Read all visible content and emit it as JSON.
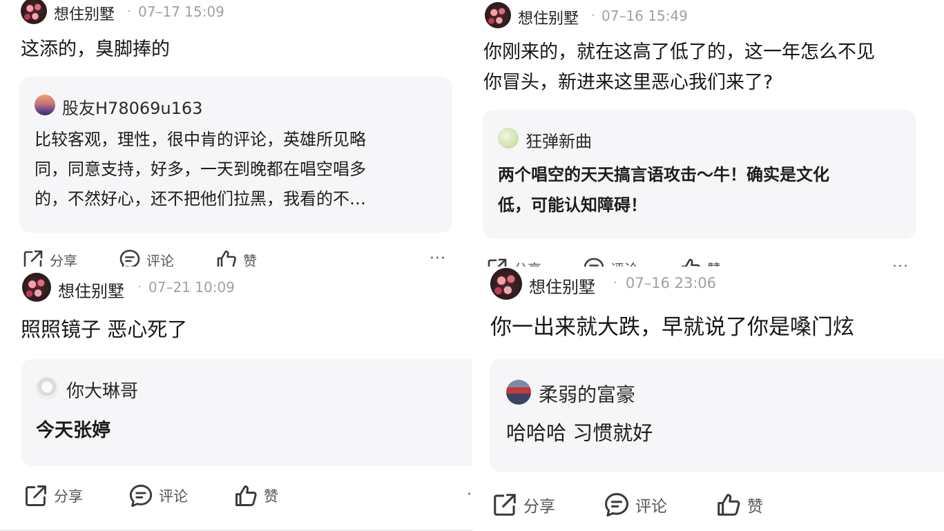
{
  "posts": [
    {
      "author": "想住别墅",
      "dot": "·",
      "time": "07–17 15:09",
      "text": [
        "这添的，臭脚捧的"
      ],
      "quote": {
        "author": "股友H78069u163",
        "text": [
          "比较客观，理性，很中肯的评论，英雄所见略",
          "同，同意支持，好多，一天到晚都在唱空唱多",
          "的，不然好心，还不把他们拉黑，我看的不…"
        ]
      },
      "actions": {
        "share": "分享",
        "comment": "评论",
        "like": "赞"
      },
      "more": "···"
    },
    {
      "author": "想住别墅",
      "dot": "·",
      "time": "07–16 15:49",
      "text": [
        "你刚来的，就在这高了低了的，这一年怎么不见",
        "你冒头，新进来这里恶心我们来了?"
      ],
      "quote": {
        "author": "狂弹新曲",
        "text": [
          "两个唱空的天天搞言语攻击～牛！确实是文化",
          "低，可能认知障碍！"
        ]
      },
      "actions": {
        "share": "分享",
        "comment": "评论",
        "like": "赞"
      },
      "more": "···"
    },
    {
      "author": "想住别墅",
      "dot": "·",
      "time": "07–21 10:09",
      "text": [
        "照照镜子 恶心死了"
      ],
      "quote": {
        "author": "你大琳哥",
        "text": [
          "今天张婷"
        ]
      },
      "actions": {
        "share": "分享",
        "comment": "评论",
        "like": "赞"
      },
      "more": "·"
    },
    {
      "author": "想住别墅",
      "dot": "·",
      "time": "07–16 23:06",
      "text": [
        "你一出来就大跌，早就说了你是嗓门炫"
      ],
      "quote": {
        "author": "柔弱的富豪",
        "text": [
          "哈哈哈 习惯就好"
        ]
      },
      "actions": {
        "share": "分享",
        "comment": "评论",
        "like": "赞"
      },
      "more": ""
    }
  ],
  "colors": {
    "bubble": "#f6f6f8",
    "muted": "#a0a0a0",
    "text": "#161616"
  }
}
